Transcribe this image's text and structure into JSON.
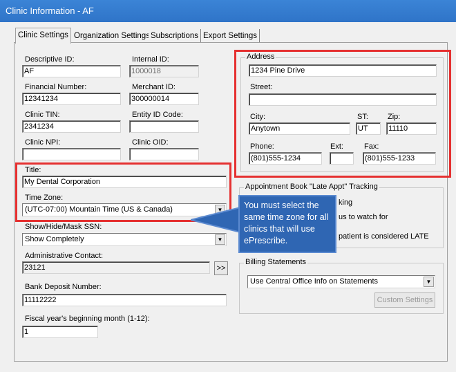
{
  "window": {
    "title": "Clinic Information - AF"
  },
  "tabs": [
    {
      "label": "Clinic Settings"
    },
    {
      "label": "Organization Settings"
    },
    {
      "label": "Subscriptions"
    },
    {
      "label": "Export Settings"
    }
  ],
  "left": {
    "descriptive_id": {
      "label": "Descriptive ID:",
      "value": "AF"
    },
    "internal_id": {
      "label": "Internal ID:",
      "value": "1000018"
    },
    "financial_number": {
      "label": "Financial Number:",
      "value": "12341234"
    },
    "merchant_id": {
      "label": "Merchant ID:",
      "value": "300000014"
    },
    "clinic_tin": {
      "label": "Clinic TIN:",
      "value": "2341234"
    },
    "entity_id_code": {
      "label": "Entity ID Code:",
      "value": ""
    },
    "clinic_npi": {
      "label": "Clinic NPI:",
      "value": ""
    },
    "clinic_oid": {
      "label": "Clinic OID:",
      "value": ""
    },
    "title": {
      "label": "Title:",
      "value": "My Dental Corporation"
    },
    "time_zone": {
      "label": "Time Zone:",
      "value": "(UTC-07:00) Mountain Time (US & Canada)"
    },
    "ssn": {
      "label": "Show/Hide/Mask SSN:",
      "value": "Show Completely"
    },
    "admin_contact": {
      "label": "Administrative Contact:",
      "value": "23121",
      "button": ">>"
    },
    "bank_deposit": {
      "label": "Bank Deposit Number:",
      "value": "11112222"
    },
    "fiscal_month": {
      "label": "Fiscal year's beginning month (1-12):",
      "value": "1"
    }
  },
  "address": {
    "group_label": "Address",
    "address_value": "1234 Pine Drive",
    "street": {
      "label": "Street:",
      "value": ""
    },
    "city": {
      "label": "City:",
      "value": "Anytown"
    },
    "st": {
      "label": "ST:",
      "value": "UT"
    },
    "zip": {
      "label": "Zip:",
      "value": "11110"
    },
    "phone": {
      "label": "Phone:",
      "value": "(801)555-1234"
    },
    "ext": {
      "label": "Ext:",
      "value": ""
    },
    "fax": {
      "label": "Fax:",
      "value": "(801)555-1233"
    }
  },
  "appt_tracking": {
    "group_label": "Appointment Book \"Late Appt\" Tracking",
    "line1": "king",
    "line2": "us to watch for",
    "line3": "patient is considered LATE"
  },
  "billing": {
    "group_label": "Billing Statements",
    "selected": "Use Central Office Info on Statements",
    "custom_button": "Custom Settings"
  },
  "callout": {
    "text": "You must select the same time zone for all clinics that will use ePrescribe."
  },
  "colors": {
    "highlight": "#e53030",
    "callout_bg": "#2f66b3",
    "titlebar": "#2f74c8"
  }
}
